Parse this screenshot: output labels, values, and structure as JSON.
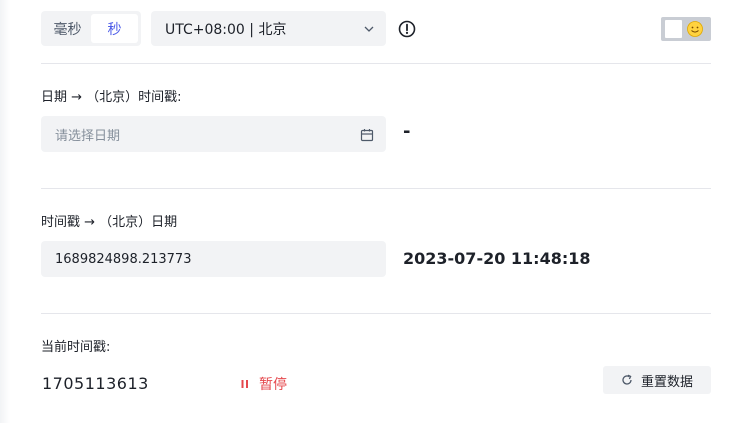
{
  "unit_toggle": {
    "options": [
      "毫秒",
      "秒"
    ],
    "selected": "秒"
  },
  "timezone": {
    "value": "UTC+08:00 | 北京"
  },
  "icons": {
    "info": "info-circle-icon",
    "chevron": "chevron-down-icon",
    "theme": "smiley-emoji-icon",
    "calendar": "calendar-icon",
    "pause": "pause-icon",
    "refresh": "refresh-icon"
  },
  "date_to_ts": {
    "label": "日期 → （北京）时间戳:",
    "placeholder": "请选择日期",
    "result": "-"
  },
  "ts_to_date": {
    "label": "时间戳 → （北京）日期",
    "input_value": "1689824898.213773",
    "result": "2023-07-20 11:48:18"
  },
  "current": {
    "label": "当前时间戳:",
    "value": "1705113613",
    "pause_label": "暂停",
    "reset_label": "重置数据"
  },
  "colors": {
    "accent": "#4d5ce8",
    "danger": "#e5484d",
    "field_bg": "#f2f3f5",
    "divider": "#e5e6eb"
  }
}
